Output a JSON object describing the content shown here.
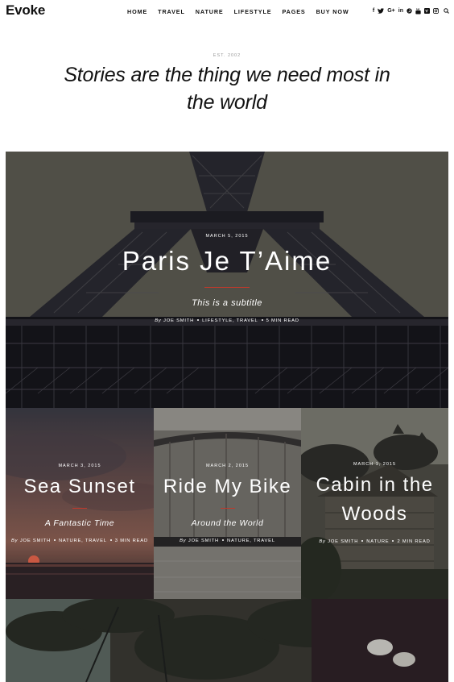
{
  "site": {
    "logo": "Evoke"
  },
  "nav": {
    "items": [
      {
        "label": "HOME"
      },
      {
        "label": "TRAVEL"
      },
      {
        "label": "NATURE"
      },
      {
        "label": "LIFESTYLE"
      },
      {
        "label": "PAGES"
      },
      {
        "label": "BUY NOW"
      }
    ]
  },
  "social": {
    "facebook": "f",
    "googleplus": "G+",
    "linkedin": "in",
    "icons": [
      "facebook-icon",
      "twitter-icon",
      "googleplus-icon",
      "linkedin-icon",
      "pinterest-icon",
      "youtube-icon",
      "vimeo-icon",
      "instagram-icon",
      "search-icon"
    ]
  },
  "intro": {
    "est": "EST. 2002",
    "tagline": "Stories are the thing we need most in the world"
  },
  "hero": {
    "date": "MARCH 5, 2015",
    "title": "Paris Je T’Aime",
    "subtitle": "This is a subtitle",
    "by": "By",
    "author": "JOE SMITH",
    "categories": "LIFESTYLE, TRAVEL",
    "read_time": "5 MIN READ"
  },
  "cards": [
    {
      "date": "MARCH 3, 2015",
      "title": "Sea Sunset",
      "subtitle": "A Fantastic Time",
      "by": "By",
      "author": "JOE SMITH",
      "categories": "NATURE, TRAVEL",
      "read_time": "3 MIN READ"
    },
    {
      "date": "MARCH 2, 2015",
      "title": "Ride My Bike",
      "subtitle": "Around the World",
      "by": "By",
      "author": "JOE SMITH",
      "categories": "NATURE, TRAVEL"
    },
    {
      "date": "MARCH 1, 2015",
      "title_line1": "Cabin in the",
      "title_line2": "Woods",
      "by": "By",
      "author": "JOE SMITH",
      "categories": "NATURE",
      "read_time": "2 MIN READ"
    }
  ],
  "colors": {
    "accent": "#c0392b",
    "text": "#111111",
    "muted": "#999999"
  }
}
